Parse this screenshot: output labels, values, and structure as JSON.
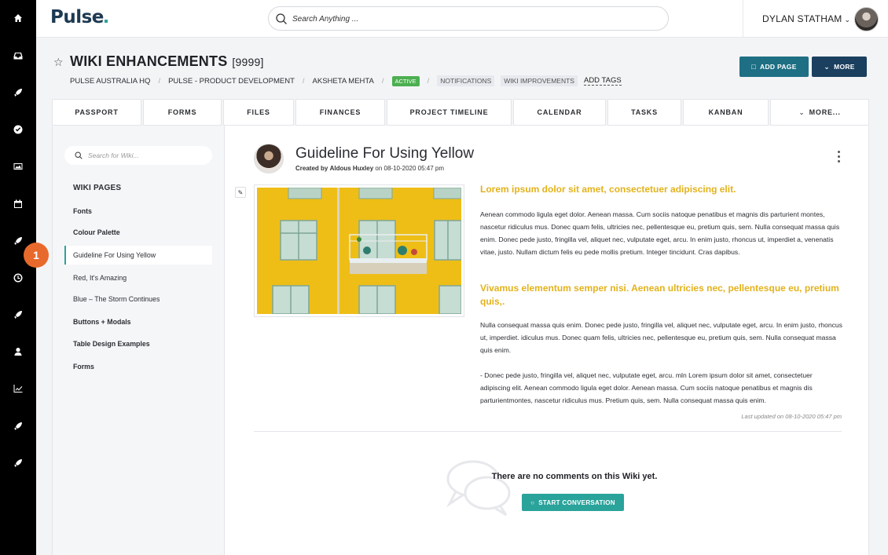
{
  "rail": {
    "icons": [
      "home-icon",
      "inbox-icon",
      "rocket-icon",
      "check-circle-icon",
      "image-icon",
      "calendar-icon",
      "rocket-icon",
      "clock-icon",
      "rocket-icon",
      "user-icon",
      "chart-icon",
      "rocket-icon",
      "rocket-icon"
    ]
  },
  "topbar": {
    "logo": "Pulse",
    "search_placeholder": "Search Anything ...",
    "user_name": "DYLAN STATHAM"
  },
  "header": {
    "title": "WIKI ENHANCEMENTS",
    "id": "[9999]",
    "breadcrumbs": [
      "PULSE AUSTRALIA HQ",
      "PULSE - PRODUCT DEVELOPMENT",
      "AKSHETA MEHTA"
    ],
    "status": "ACTIVE",
    "tags": [
      "NOTIFICATIONS",
      "WIKI IMPROVEMENTS"
    ],
    "add_tags": "ADD TAGS",
    "add_page": "ADD PAGE",
    "more": "MORE"
  },
  "tabs": [
    "PASSPORT",
    "FORMS",
    "FILES",
    "FINANCES",
    "PROJECT TIMELINE",
    "CALENDAR",
    "TASKS",
    "KANBAN",
    "MORE..."
  ],
  "sidebar": {
    "search_placeholder": "Search for Wiki...",
    "heading": "WIKI PAGES",
    "items": [
      {
        "label": "Fonts",
        "bold": true
      },
      {
        "label": "Colour Palette",
        "bold": true
      },
      {
        "label": "Guideline For Using Yellow",
        "selected": true
      },
      {
        "label": "Red, It's Amazing"
      },
      {
        "label": "Blue – The Storm Continues"
      },
      {
        "label": "Buttons + Modals",
        "bold": true
      },
      {
        "label": "Table Design Examples",
        "bold": true
      },
      {
        "label": "Forms",
        "bold": true
      }
    ]
  },
  "doc": {
    "title": "Guideline For Using Yellow",
    "created_prefix": "Created by",
    "author": "Aldous Huxley",
    "created_on": "on 08-10-2020 05:47 pm",
    "heading1": "Lorem ipsum dolor sit amet, consectetuer adipiscing elit.",
    "para1": "Aenean commodo ligula eget dolor. Aenean massa. Cum sociis natoque penatibus et magnis dis parturient montes, nascetur ridiculus mus. Donec quam felis, ultricies nec, pellentesque eu, pretium quis, sem. Nulla consequat massa quis enim. Donec pede justo, fringilla vel, aliquet nec, vulputate eget, arcu. In enim justo, rhoncus ut, imperdiet a, venenatis vitae, justo. Nullam dictum felis eu pede mollis pretium. Integer tincidunt. Cras dapibus.",
    "heading2": "Vivamus elementum semper nisi. Aenean ultricies nec, pellentesque eu, pretium quis,.",
    "para2": "Nulla consequat massa quis enim. Donec pede justo, fringilla vel, aliquet nec, vulputate eget, arcu. In enim justo, rhoncus ut, imperdiet. idiculus mus. Donec quam felis, ultricies nec, pellentesque eu, pretium quis, sem. Nulla consequat massa quis enim.",
    "para3": "- Donec pede justo, fringilla vel, aliquet nec, vulputate eget, arcu. mln Lorem ipsum dolor sit amet, consectetuer adipiscing elit. Aenean commodo ligula eget dolor. Aenean massa. Cum sociis natoque penatibus et magnis dis parturientmontes, nascetur ridiculus mus. Pretium quis, sem. Nulla consequat massa quis enim.",
    "updated": "Last updated on 08-10-2020 05:47 pm"
  },
  "comments": {
    "empty_text": "There are no comments on this Wiki yet.",
    "start_button": "START CONVERSATION"
  },
  "step_marker": "1",
  "colors": {
    "accent_teal": "#2aa39b",
    "brand_navy": "#1a3f5f",
    "highlight_yellow": "#e3b21b",
    "status_green": "#4caf50",
    "step_orange": "#e8692c"
  }
}
